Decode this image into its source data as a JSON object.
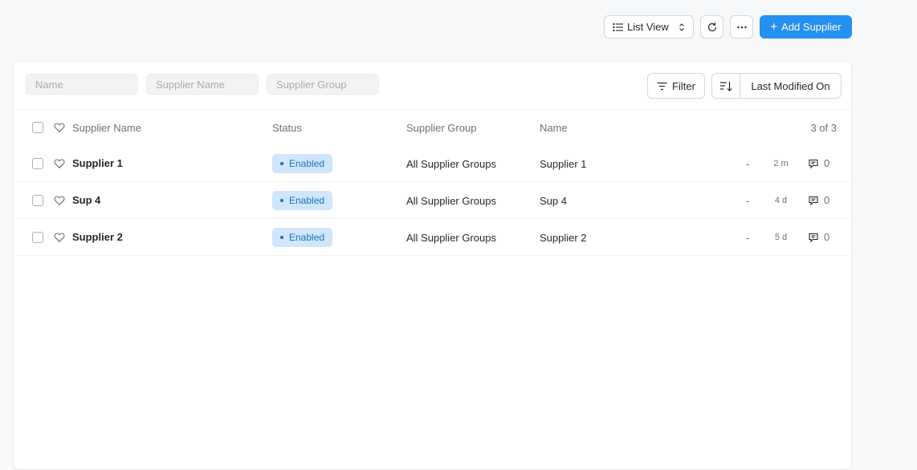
{
  "toolbar": {
    "list_view_label": "List View",
    "add_label": "Add Supplier",
    "reload_icon": "reload-icon",
    "more_icon": "ellipsis-icon"
  },
  "filters": {
    "name_placeholder": "Name",
    "supplier_name_placeholder": "Supplier Name",
    "supplier_group_placeholder": "Supplier Group",
    "filter_label": "Filter",
    "sort_label": "Last Modified On"
  },
  "columns": {
    "supplier_name": "Supplier Name",
    "status": "Status",
    "supplier_group": "Supplier Group",
    "name": "Name",
    "count": "3 of 3"
  },
  "rows": [
    {
      "supplier_name": "Supplier 1",
      "status": "Enabled",
      "group": "All Supplier Groups",
      "name": "Supplier 1",
      "dash": "-",
      "age": "2 m",
      "comments": "0"
    },
    {
      "supplier_name": "Sup 4",
      "status": "Enabled",
      "group": "All Supplier Groups",
      "name": "Sup 4",
      "dash": "-",
      "age": "4 d",
      "comments": "0"
    },
    {
      "supplier_name": "Supplier 2",
      "status": "Enabled",
      "group": "All Supplier Groups",
      "name": "Supplier 2",
      "dash": "-",
      "age": "5 d",
      "comments": "0"
    }
  ],
  "colors": {
    "primary": "#2490ef",
    "badge_bg": "#cfe6fb",
    "badge_text": "#1c70b9"
  }
}
